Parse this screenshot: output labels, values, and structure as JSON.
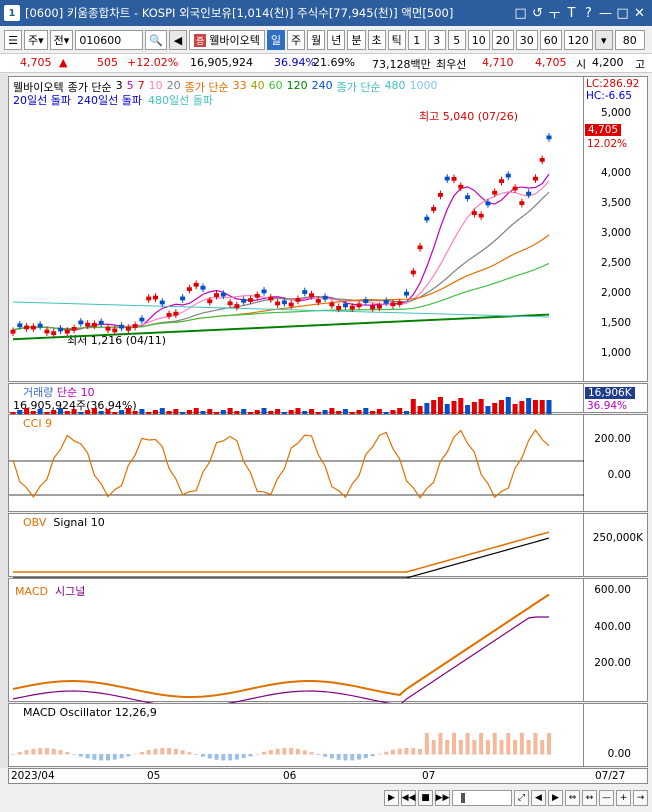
{
  "window": {
    "number": "1",
    "title": "[0600] 키움종합차트 - KOSPI 외국인보유[1,014(천)] 주식수[77,945(천)] 액면[500]",
    "buttons": [
      "□",
      "↺",
      "ㅜ",
      "T",
      "?",
      "—",
      "□",
      "✕"
    ]
  },
  "toolbar": {
    "period_type": "주",
    "price_mode": "전",
    "code": "010600",
    "stock_name": "웰바이오텍",
    "name_badge": "증",
    "period_tabs": [
      "일",
      "주",
      "월",
      "년",
      "분",
      "초",
      "틱"
    ],
    "active_period": "일",
    "intervals": [
      "1",
      "3",
      "5",
      "10",
      "20",
      "30",
      "60",
      "120"
    ],
    "count": "80"
  },
  "quote": {
    "price": "4,705",
    "arrow": "▲",
    "change": "505",
    "change_pct": "+12.02%",
    "volume": "16,905,924",
    "volume_ratio": "36.94%",
    "turnover": "21.69%",
    "amount": "73,128백만",
    "best_bid_label": "최우선",
    "best_bid": "4,710",
    "best_ask": "4,705",
    "open_label": "시",
    "open": "4,200",
    "high_label": "고"
  },
  "price_panel": {
    "legend_line1": [
      {
        "text": "웰바이오텍",
        "color": "#000000"
      },
      {
        "text": "종가 단순",
        "color": "#000000"
      },
      {
        "text": "3",
        "color": "#000000"
      },
      {
        "text": "5",
        "color": "#c000c0"
      },
      {
        "text": "7",
        "color": "#e00000"
      },
      {
        "text": "10",
        "color": "#ff80c0"
      },
      {
        "text": "20",
        "color": "#808080"
      },
      {
        "text": "종가 단순",
        "color": "#e07000"
      },
      {
        "text": "33",
        "color": "#e07000"
      },
      {
        "text": "40",
        "color": "#a0a000"
      },
      {
        "text": "60",
        "color": "#40c040"
      },
      {
        "text": "120",
        "color": "#008000"
      },
      {
        "text": "240",
        "color": "#0050d0"
      },
      {
        "text": "종가 단순",
        "color": "#40c0c0"
      },
      {
        "text": "480",
        "color": "#40c0c0"
      },
      {
        "text": "1000",
        "color": "#80c0ff"
      }
    ],
    "legend_line2": [
      {
        "text": "20일선 돌파",
        "color": "#0000d0"
      },
      {
        "text": "240일선 돌파",
        "color": "#0000d0"
      },
      {
        "text": "480일선 돌파",
        "color": "#40c0c0"
      }
    ],
    "lc_label": "LC:286.92",
    "hc_label": "HC:-6.65",
    "current_price_tag": "4,705",
    "current_pct_tag": "12.02%",
    "high_annotation": "최고 5,040 (07/26)",
    "low_annotation": "최저 1,216 (04/11)",
    "y_ticks": [
      "5,000",
      "4,500",
      "4,000",
      "3,500",
      "3,000",
      "2,500",
      "2,000",
      "1,500",
      "1,000"
    ]
  },
  "volume_panel": {
    "title": "거래량",
    "title_suffix": "단순 10",
    "info": "16,905,924주(36.94%)",
    "tag_value": "16,906K",
    "tag_pct": "36.94%"
  },
  "cci_panel": {
    "title": "CCI 9",
    "y_ticks": [
      "200.00",
      "0.00"
    ]
  },
  "obv_panel": {
    "title": "OBV",
    "signal": "Signal 10",
    "y_ticks": [
      "250,000K"
    ]
  },
  "macd_panel": {
    "title": "MACD",
    "signal": "시그널",
    "y_ticks": [
      "600.00",
      "400.00",
      "200.00"
    ]
  },
  "osc_panel": {
    "title": "MACD Oscillator 12,26,9",
    "y_ticks": [
      "0.00"
    ]
  },
  "x_axis": {
    "labels": [
      "2023/04",
      "05",
      "06",
      "07"
    ],
    "right_label": "07/27"
  },
  "colors": {
    "up": "#e00000",
    "down": "#0050c8",
    "titlebar": "#2c5d9e",
    "accent": "#2f6fc4"
  }
}
